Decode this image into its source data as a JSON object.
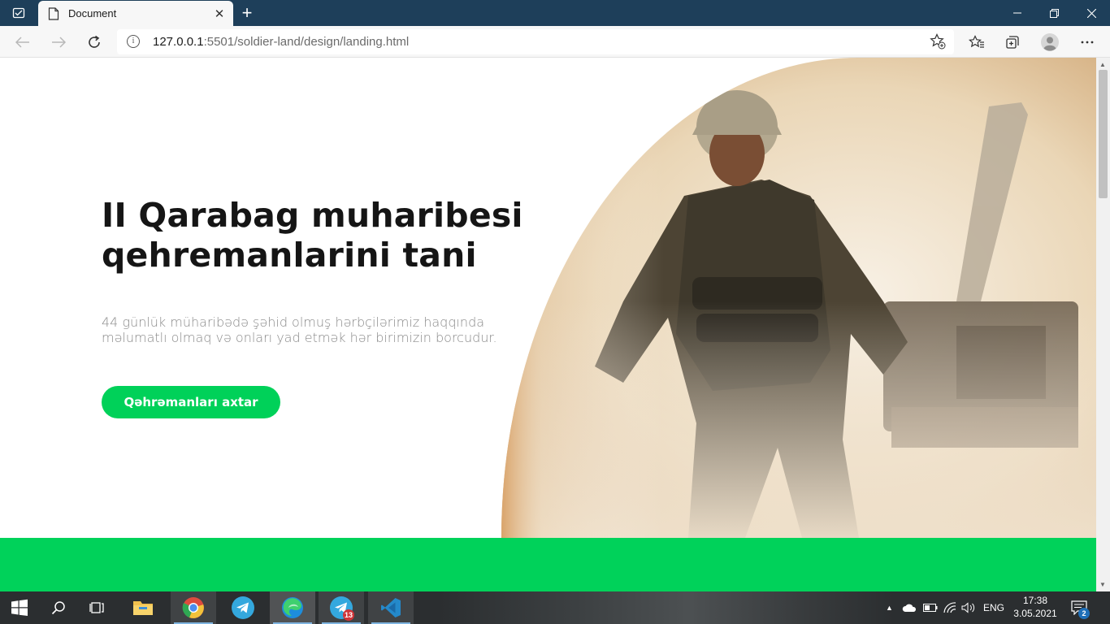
{
  "browser": {
    "tab_title": "Document",
    "url_host": "127.0.0.1",
    "url_path": ":5501/soldier-land/design/landing.html"
  },
  "hero": {
    "title_line1": "II Qarabag muharibesi",
    "title_line2": "qehremanlarini tani",
    "subtitle": "44 günlük müharibədə şəhid olmuş hərbçilərimiz haqqında məlumatlı olmaq və onları yad etmək hər birimizin borcudur.",
    "cta_label": "Qəhrəmanları axtar"
  },
  "colors": {
    "accent_green": "#00d25a",
    "titlebar": "#1e3f5a"
  },
  "taskbar": {
    "apps": [
      "start-icon",
      "search-icon",
      "task-view-icon",
      "file-explorer-icon",
      "chrome-icon",
      "telegram-icon",
      "edge-icon",
      "telegram-icon",
      "vscode-icon"
    ],
    "telegram_badge": "13",
    "language": "ENG",
    "time": "17:38",
    "date": "3.05.2021",
    "notification_count": "2"
  }
}
